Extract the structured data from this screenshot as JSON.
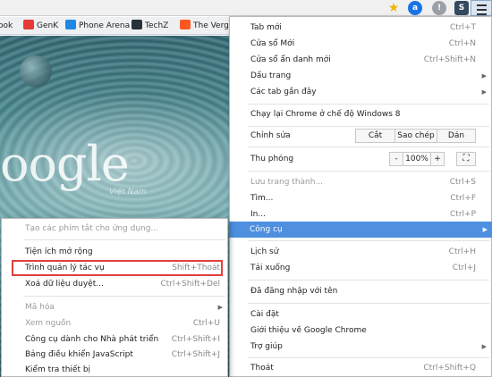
{
  "toolbar": {
    "ext1": "a",
    "ext2": "!",
    "ext3": "S"
  },
  "bookmarks": [
    {
      "label": "ook",
      "color": "#ffffff"
    },
    {
      "label": "GenK",
      "color": "#e53935"
    },
    {
      "label": "Phone Arena",
      "color": "#1e88e5"
    },
    {
      "label": "TechZ",
      "color": "#ffffff"
    },
    {
      "label": "The Verge",
      "color": "#ff5722"
    }
  ],
  "background": {
    "logo": "oogle",
    "sub": "Việt Nam"
  },
  "main_menu": {
    "new_tab": {
      "label": "Tab mới",
      "shortcut": "Ctrl+T"
    },
    "new_window": {
      "label": "Cửa sổ Mới",
      "shortcut": "Ctrl+N"
    },
    "incognito": {
      "label": "Cửa sổ ẩn danh mới",
      "shortcut": "Ctrl+Shift+N"
    },
    "bookmarks": {
      "label": "Dấu trang"
    },
    "recent_tabs": {
      "label": "Các tab gần đây"
    },
    "win8_mode": {
      "label": "Chạy lại Chrome ở chế độ Windows 8"
    },
    "edit": {
      "label": "Chỉnh sửa",
      "cut": "Cắt",
      "copy": "Sao chép",
      "paste": "Dán"
    },
    "zoom": {
      "label": "Thu phóng",
      "minus": "-",
      "level": "100%",
      "plus": "+"
    },
    "save_page": {
      "label": "Lưu trang thành...",
      "shortcut": "Ctrl+S"
    },
    "find": {
      "label": "Tìm...",
      "shortcut": "Ctrl+F"
    },
    "print": {
      "label": "In...",
      "shortcut": "Ctrl+P"
    },
    "tools": {
      "label": "Công cụ"
    },
    "history": {
      "label": "Lịch sử",
      "shortcut": "Ctrl+H"
    },
    "downloads": {
      "label": "Tải xuống",
      "shortcut": "Ctrl+J"
    },
    "signed_in": {
      "label": "Đã đăng nhập với tên"
    },
    "settings": {
      "label": "Cài đặt"
    },
    "about": {
      "label": "Giới thiệu về Google Chrome"
    },
    "help": {
      "label": "Trợ giúp"
    },
    "exit": {
      "label": "Thoát",
      "shortcut": "Ctrl+Shift+Q"
    }
  },
  "sub_menu": {
    "create_shortcuts": {
      "label": "Tạo các phím tắt cho ứng dụng..."
    },
    "extensions": {
      "label": "Tiện ích mở rộng"
    },
    "task_manager": {
      "label": "Trình quản lý tác vụ",
      "shortcut": "Shift+Thoát"
    },
    "clear_data": {
      "label": "Xoá dữ liệu duyệt...",
      "shortcut": "Ctrl+Shift+Del"
    },
    "encoding": {
      "label": "Mã hóa"
    },
    "view_source": {
      "label": "Xem nguồn",
      "shortcut": "Ctrl+U"
    },
    "dev_tools": {
      "label": "Công cụ dành cho Nhà phát triển",
      "shortcut": "Ctrl+Shift+I"
    },
    "js_console": {
      "label": "Bảng điều khiển JavaScript",
      "shortcut": "Ctrl+Shift+J"
    },
    "inspect": {
      "label": "Kiểm tra thiết bị"
    }
  },
  "colors": {
    "highlight": "#4e8fe0",
    "annotation_box": "#e0403c"
  }
}
